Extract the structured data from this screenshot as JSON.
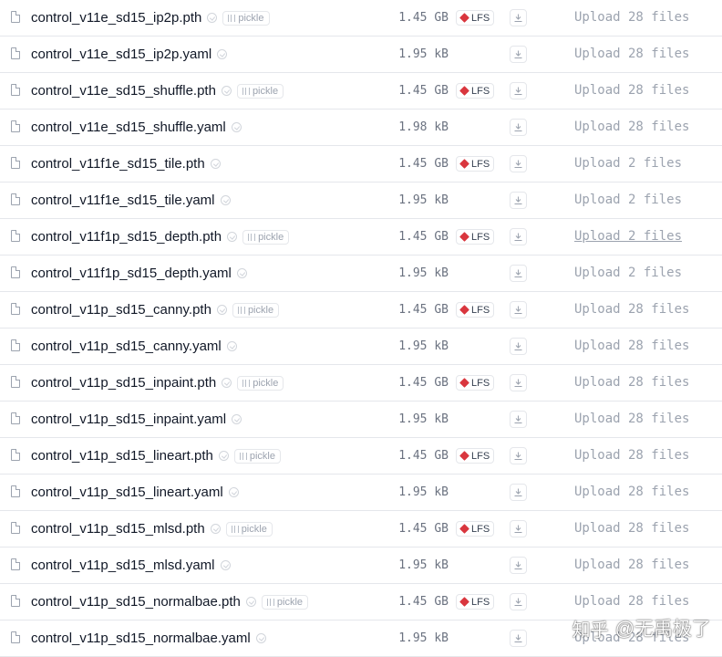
{
  "files": [
    {
      "name": "control_v11e_sd15_ip2p.pth",
      "size": "1.45 GB",
      "pickle": true,
      "lfs": true,
      "commit": "Upload 28 files",
      "commit_underlined": false
    },
    {
      "name": "control_v11e_sd15_ip2p.yaml",
      "size": "1.95 kB",
      "pickle": false,
      "lfs": false,
      "commit": "Upload 28 files",
      "commit_underlined": false
    },
    {
      "name": "control_v11e_sd15_shuffle.pth",
      "size": "1.45 GB",
      "pickle": true,
      "lfs": true,
      "commit": "Upload 28 files",
      "commit_underlined": false
    },
    {
      "name": "control_v11e_sd15_shuffle.yaml",
      "size": "1.98 kB",
      "pickle": false,
      "lfs": false,
      "commit": "Upload 28 files",
      "commit_underlined": false
    },
    {
      "name": "control_v11f1e_sd15_tile.pth",
      "size": "1.45 GB",
      "pickle": false,
      "lfs": true,
      "commit": "Upload 2 files",
      "commit_underlined": false
    },
    {
      "name": "control_v11f1e_sd15_tile.yaml",
      "size": "1.95 kB",
      "pickle": false,
      "lfs": false,
      "commit": "Upload 2 files",
      "commit_underlined": false
    },
    {
      "name": "control_v11f1p_sd15_depth.pth",
      "size": "1.45 GB",
      "pickle": true,
      "lfs": true,
      "commit": "Upload 2 files",
      "commit_underlined": true
    },
    {
      "name": "control_v11f1p_sd15_depth.yaml",
      "size": "1.95 kB",
      "pickle": false,
      "lfs": false,
      "commit": "Upload 2 files",
      "commit_underlined": false
    },
    {
      "name": "control_v11p_sd15_canny.pth",
      "size": "1.45 GB",
      "pickle": true,
      "lfs": true,
      "commit": "Upload 28 files",
      "commit_underlined": false
    },
    {
      "name": "control_v11p_sd15_canny.yaml",
      "size": "1.95 kB",
      "pickle": false,
      "lfs": false,
      "commit": "Upload 28 files",
      "commit_underlined": false
    },
    {
      "name": "control_v11p_sd15_inpaint.pth",
      "size": "1.45 GB",
      "pickle": true,
      "lfs": true,
      "commit": "Upload 28 files",
      "commit_underlined": false
    },
    {
      "name": "control_v11p_sd15_inpaint.yaml",
      "size": "1.95 kB",
      "pickle": false,
      "lfs": false,
      "commit": "Upload 28 files",
      "commit_underlined": false
    },
    {
      "name": "control_v11p_sd15_lineart.pth",
      "size": "1.45 GB",
      "pickle": true,
      "lfs": true,
      "commit": "Upload 28 files",
      "commit_underlined": false
    },
    {
      "name": "control_v11p_sd15_lineart.yaml",
      "size": "1.95 kB",
      "pickle": false,
      "lfs": false,
      "commit": "Upload 28 files",
      "commit_underlined": false
    },
    {
      "name": "control_v11p_sd15_mlsd.pth",
      "size": "1.45 GB",
      "pickle": true,
      "lfs": true,
      "commit": "Upload 28 files",
      "commit_underlined": false
    },
    {
      "name": "control_v11p_sd15_mlsd.yaml",
      "size": "1.95 kB",
      "pickle": false,
      "lfs": false,
      "commit": "Upload 28 files",
      "commit_underlined": false
    },
    {
      "name": "control_v11p_sd15_normalbae.pth",
      "size": "1.45 GB",
      "pickle": true,
      "lfs": true,
      "commit": "Upload 28 files",
      "commit_underlined": false
    },
    {
      "name": "control_v11p_sd15_normalbae.yaml",
      "size": "1.95 kB",
      "pickle": false,
      "lfs": false,
      "commit": "Upload 28 files",
      "commit_underlined": false
    }
  ],
  "badges": {
    "pickle_label": "pickle",
    "lfs_label": "LFS"
  },
  "icons": {
    "file": "file-icon",
    "verified": "verified-icon",
    "pickle": "pickle-icon",
    "lfs": "lfs-icon",
    "download": "download-icon"
  },
  "colors": {
    "lfs_icon": "#d9363e",
    "muted_text": "#9ca3af",
    "row_divider": "#e5e7eb"
  },
  "watermark": {
    "platform": "知乎",
    "handle": "@无禹极了"
  }
}
